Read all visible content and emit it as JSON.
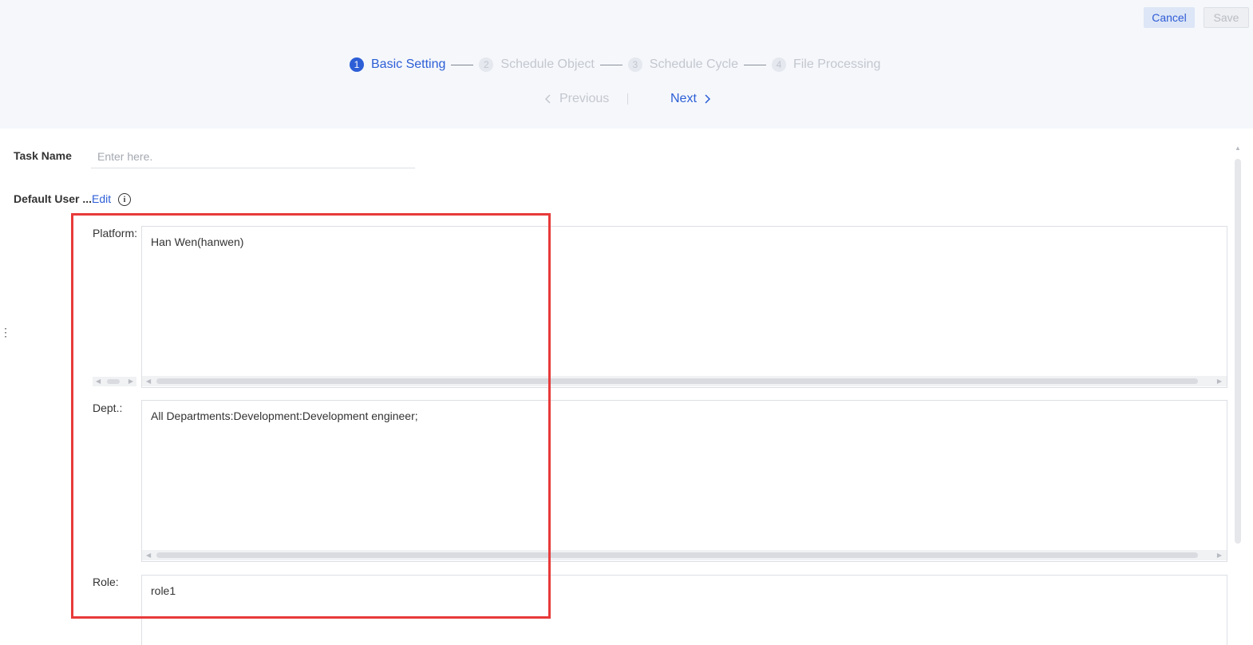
{
  "toolbar": {
    "cancel_label": "Cancel",
    "save_label": "Save"
  },
  "steps": [
    {
      "number": "1",
      "label": "Basic Setting"
    },
    {
      "number": "2",
      "label": "Schedule Object"
    },
    {
      "number": "3",
      "label": "Schedule Cycle"
    },
    {
      "number": "4",
      "label": "File Processing"
    }
  ],
  "pager": {
    "previous_label": "Previous",
    "next_label": "Next"
  },
  "form": {
    "task_name_label": "Task Name",
    "task_name_placeholder": "Enter here.",
    "default_user_label": "Default User ...",
    "edit_label": "Edit",
    "platform_label": "Platform:",
    "platform_value": "Han Wen(hanwen)",
    "dept_label": "Dept.:",
    "dept_value": "All Departments:Development:Development engineer;",
    "role_label": "Role:",
    "role_value": "role1"
  },
  "colors": {
    "accent": "#2c5ed6",
    "highlight": "#e83a3a",
    "header_bg": "#f5f7fb"
  }
}
